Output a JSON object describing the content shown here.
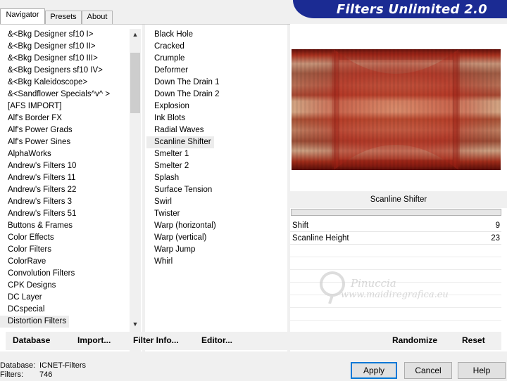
{
  "tabs": [
    "Navigator",
    "Presets",
    "About"
  ],
  "banner_title": "Filters Unlimited 2.0",
  "categories": [
    "&<Bkg Designer sf10 I>",
    "&<Bkg Designer sf10 II>",
    "&<Bkg Designer sf10 III>",
    "&<Bkg Designers sf10 IV>",
    "&<Bkg Kaleidoscope>",
    "&<Sandflower Specials^v^ >",
    "[AFS IMPORT]",
    "Alf's Border FX",
    "Alf's Power Grads",
    "Alf's Power Sines",
    "AlphaWorks",
    "Andrew's Filters 10",
    "Andrew's Filters 11",
    "Andrew's Filters 22",
    "Andrew's Filters 3",
    "Andrew's Filters 51",
    "Buttons & Frames",
    "Color Effects",
    "Color Filters",
    "ColorRave",
    "Convolution Filters",
    "CPK Designs",
    "DC Layer",
    "DCspecial",
    "Distortion Filters"
  ],
  "selected_category": "Distortion Filters",
  "filters": [
    "Black Hole",
    "Cracked",
    "Crumple",
    "Deformer",
    "Down The Drain 1",
    "Down The Drain 2",
    "Explosion",
    "Ink Blots",
    "Radial Waves",
    "Scanline Shifter",
    "Smelter 1",
    "Smelter 2",
    "Splash",
    "Surface Tension",
    "Swirl",
    "Twister",
    "Warp (horizontal)",
    "Warp (vertical)",
    "Warp Jump",
    "Whirl"
  ],
  "selected_filter": "Scanline Shifter",
  "filter_name": "Scanline Shifter",
  "params": [
    {
      "label": "Shift",
      "value": "9"
    },
    {
      "label": "Scanline Height",
      "value": "23"
    }
  ],
  "watermark": {
    "line1": "Pinuccia",
    "line2": "www.maidiregrafica.eu"
  },
  "toolbar": {
    "database": "Database",
    "import": "Import...",
    "filter_info": "Filter Info...",
    "editor": "Editor...",
    "randomize": "Randomize",
    "reset": "Reset"
  },
  "status": {
    "database_label": "Database:",
    "database_value": "ICNET-Filters",
    "filters_label": "Filters:",
    "filters_value": "746"
  },
  "buttons": {
    "apply": "Apply",
    "cancel": "Cancel",
    "help": "Help"
  },
  "icons": {
    "scroll_up": "chevron-up-icon",
    "scroll_down": "chevron-down-icon"
  }
}
